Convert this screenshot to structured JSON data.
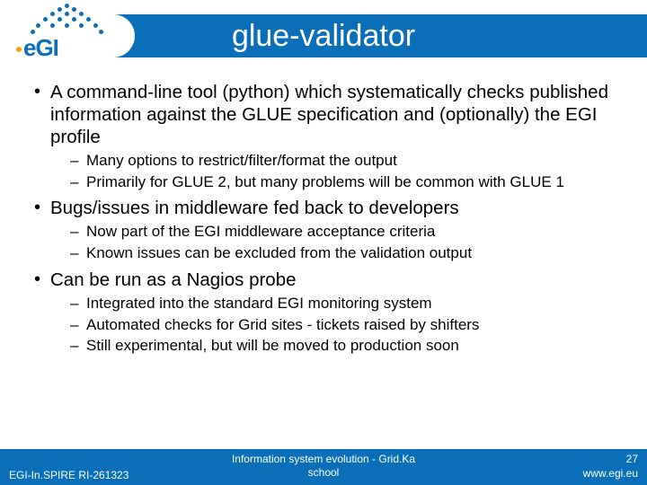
{
  "header": {
    "title": "glue-validator",
    "logo_text": "eGI"
  },
  "bullets": [
    {
      "text": "A command-line tool (python) which systematically checks published information against the GLUE specification and (optionally) the EGI profile",
      "sub": [
        "Many options to restrict/filter/format the output",
        "Primarily for GLUE 2, but many problems will be common with GLUE 1"
      ]
    },
    {
      "text": "Bugs/issues in middleware fed back to developers",
      "sub": [
        "Now part of the EGI middleware acceptance criteria",
        "Known issues can be excluded from the validation output"
      ]
    },
    {
      "text": "Can be run as a Nagios probe",
      "sub": [
        "Integrated into the standard EGI monitoring system",
        "Automated checks for Grid sites - tickets raised by shifters",
        "Still experimental, but will be moved to production soon"
      ]
    }
  ],
  "footer": {
    "left": "EGI-In.SPIRE RI-261323",
    "center_line1": "Information system evolution - Grid.Ka",
    "center_line2": "school",
    "page_num": "27",
    "url": "www.egi.eu"
  }
}
